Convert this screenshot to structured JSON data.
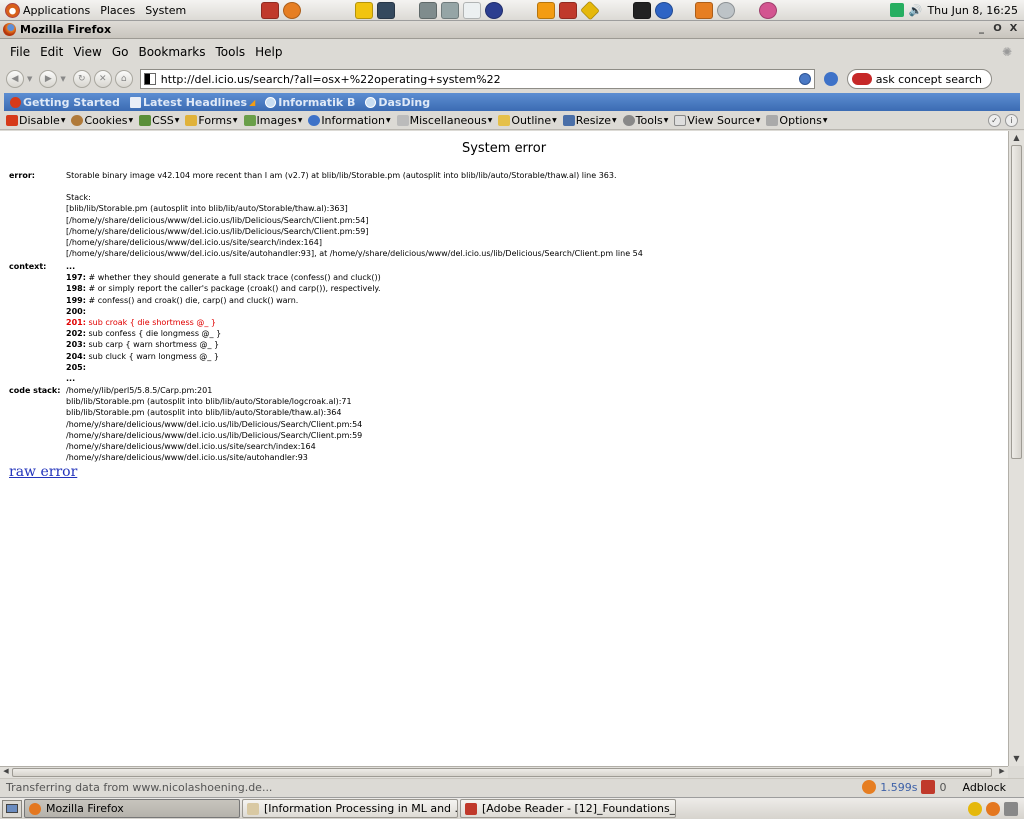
{
  "top_panel": {
    "menus": [
      "Applications",
      "Places",
      "System"
    ],
    "clock": "Thu Jun  8, 16:25"
  },
  "window": {
    "title": "Mozilla Firefox",
    "controls": [
      "_",
      "O",
      "X"
    ]
  },
  "menubar": [
    "File",
    "Edit",
    "View",
    "Go",
    "Bookmarks",
    "Tools",
    "Help"
  ],
  "navbar": {
    "url": "http://del.icio.us/search/?all=osx+%22operating+system%22",
    "search_placeholder": "ask concept search"
  },
  "bookmarks": [
    "Getting Started",
    "Latest Headlines",
    "Informatik B",
    "DasDing"
  ],
  "devbar": [
    "Disable",
    "Cookies",
    "CSS",
    "Forms",
    "Images",
    "Information",
    "Miscellaneous",
    "Outline",
    "Resize",
    "Tools",
    "View Source",
    "Options"
  ],
  "page": {
    "title": "System error",
    "error_label": "error:",
    "error_message": "Storable binary image v42.104 more recent than I am (v2.7) at blib/lib/Storable.pm (autosplit into blib/lib/auto/Storable/thaw.al) line 363.",
    "stack_lines": [
      "Stack:",
      "[blib/lib/Storable.pm (autosplit into blib/lib/auto/Storable/thaw.al):363]",
      "[/home/y/share/delicious/www/del.icio.us/lib/Delicious/Search/Client.pm:54]",
      "[/home/y/share/delicious/www/del.icio.us/lib/Delicious/Search/Client.pm:59]",
      "[/home/y/share/delicious/www/del.icio.us/site/search/index:164]",
      "[/home/y/share/delicious/www/del.icio.us/site/autohandler:93], at /home/y/share/delicious/www/del.icio.us/lib/Delicious/Search/Client.pm line 54"
    ],
    "context_label": "context:",
    "context_lines": [
      {
        "num": "...",
        "code": "",
        "highlight": false
      },
      {
        "num": "197:",
        "code": "# whether they should generate a full stack trace (confess() and cluck())",
        "highlight": false
      },
      {
        "num": "198:",
        "code": "# or simply report the caller's package (croak() and carp()), respectively.",
        "highlight": false
      },
      {
        "num": "199:",
        "code": "# confess() and croak() die, carp() and cluck() warn.",
        "highlight": false
      },
      {
        "num": "200:",
        "code": "",
        "highlight": false
      },
      {
        "num": "201:",
        "code": "sub croak { die shortmess @_ }",
        "highlight": true
      },
      {
        "num": "202:",
        "code": "sub confess { die longmess @_ }",
        "highlight": false
      },
      {
        "num": "203:",
        "code": "sub carp { warn shortmess @_ }",
        "highlight": false
      },
      {
        "num": "204:",
        "code": "sub cluck { warn longmess @_ }",
        "highlight": false
      },
      {
        "num": "205:",
        "code": "",
        "highlight": false
      },
      {
        "num": "...",
        "code": "",
        "highlight": false
      }
    ],
    "code_stack_label": "code stack:",
    "code_stack_lines": [
      "/home/y/lib/perl5/5.8.5/Carp.pm:201",
      "blib/lib/Storable.pm (autosplit into blib/lib/auto/Storable/logcroak.al):71",
      "blib/lib/Storable.pm (autosplit into blib/lib/auto/Storable/thaw.al):364",
      "/home/y/share/delicious/www/del.icio.us/lib/Delicious/Search/Client.pm:54",
      "/home/y/share/delicious/www/del.icio.us/lib/Delicious/Search/Client.pm:59",
      "/home/y/share/delicious/www/del.icio.us/site/search/index:164",
      "/home/y/share/delicious/www/del.icio.us/site/autohandler:93"
    ],
    "raw_error_link": "raw error"
  },
  "statusbar": {
    "text": "Transferring data from www.nicolashoening.de...",
    "timing": "1.599s",
    "mail_count": "0",
    "adblock": "Adblock"
  },
  "taskbar": [
    {
      "label": "Mozilla Firefox",
      "active": true
    },
    {
      "label": "[Information Processing in ML and ...",
      "active": false
    },
    {
      "label": "[Adobe Reader - [12]_Foundations_...",
      "active": false
    }
  ],
  "colors": {
    "bookmarks_bar": "#4a7cc4",
    "link": "#2233bb",
    "highlight_line": "#e00000"
  }
}
